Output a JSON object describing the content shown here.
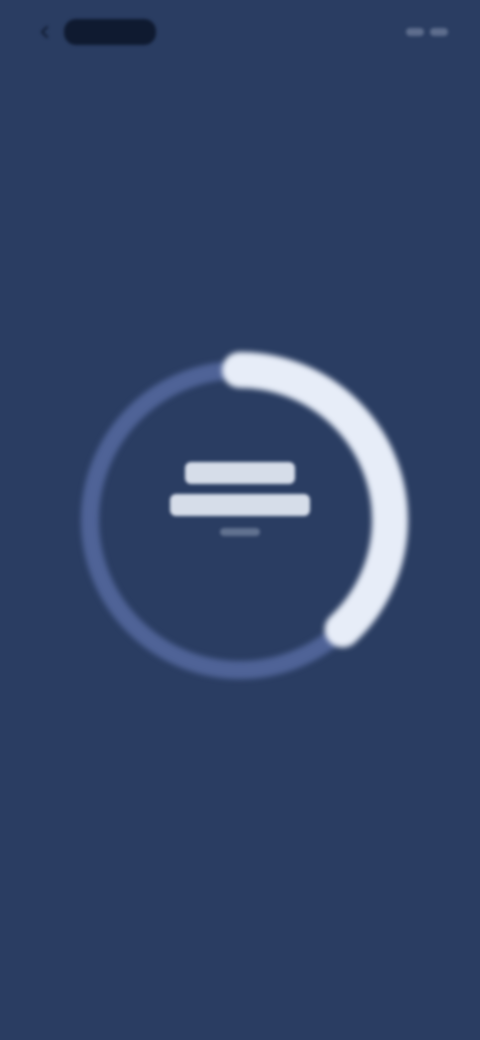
{
  "status_bar": {
    "back_icon": "chevron-left-icon",
    "left_text": "",
    "right_text": ""
  },
  "progress": {
    "value_percent": 38,
    "ring_track_color": "#4f6397",
    "ring_progress_color": "#e7edf8",
    "center_line_1": "",
    "center_line_2": "",
    "center_line_3": ""
  },
  "colors": {
    "background": "#2a3d62"
  }
}
